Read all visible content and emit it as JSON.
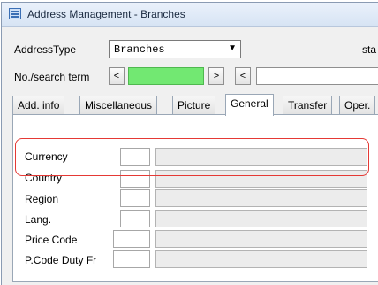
{
  "window": {
    "title": "Address Management - Branches",
    "accent_color": "#e53935"
  },
  "toolbar": {
    "address_type_label": "AddressType",
    "address_type_value": "Branches",
    "status_label": "sta",
    "search_label": "No./search term",
    "prev_label": "<",
    "next_label": ">",
    "prev2_label": "<"
  },
  "tabs": [
    {
      "label": "Add. info"
    },
    {
      "label": "Miscellaneous"
    },
    {
      "label": "Picture"
    },
    {
      "label": "General"
    },
    {
      "label": "Transfer"
    },
    {
      "label": "Oper."
    }
  ],
  "active_tab": "General",
  "fields": {
    "currency": "Currency",
    "country": "Country",
    "region": "Region",
    "lang": "Lang.",
    "price_code": "Price Code",
    "pcode_duty": "P.Code Duty Fr"
  }
}
